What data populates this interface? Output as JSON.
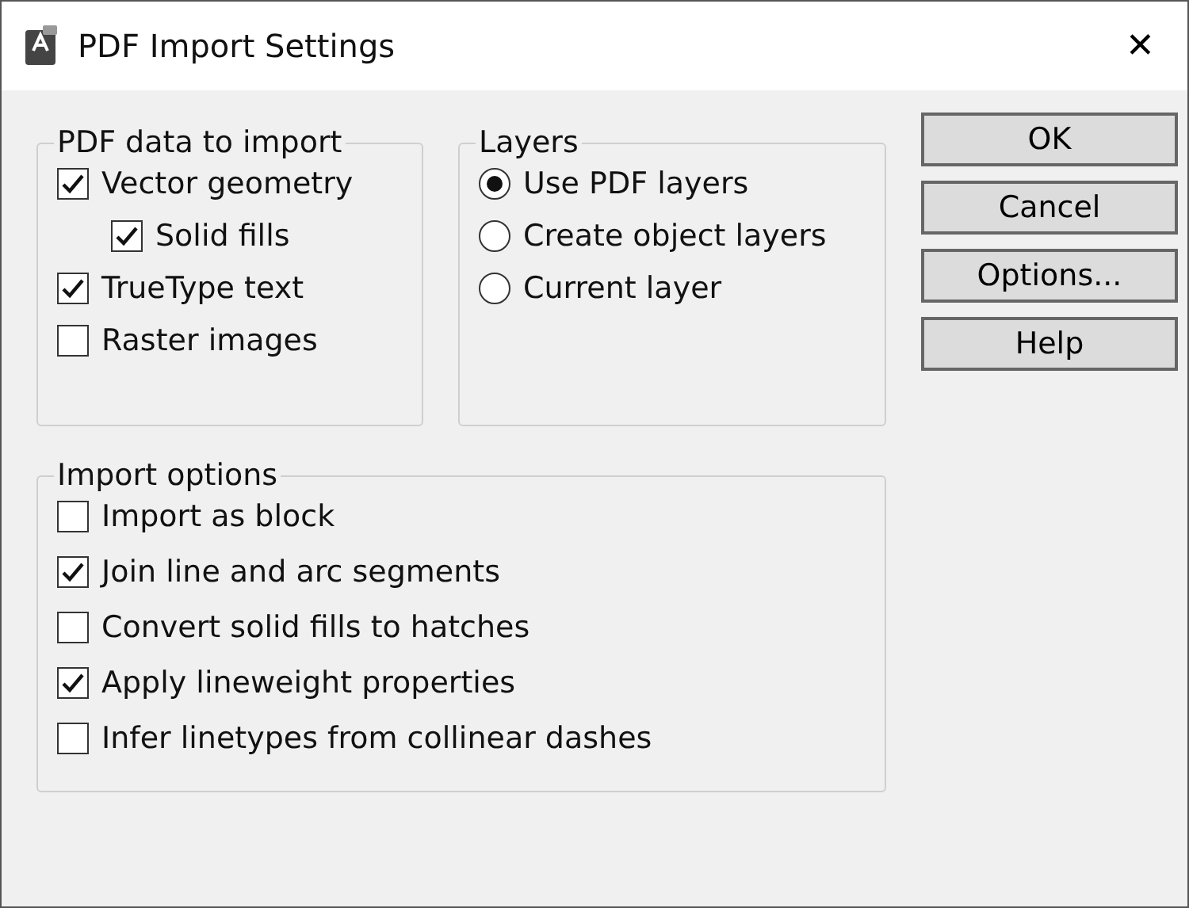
{
  "window": {
    "title": "PDF Import Settings",
    "close": "✕"
  },
  "pdf_data": {
    "title": "PDF data to import",
    "items": [
      {
        "label": "Vector geometry",
        "checked": true,
        "children": [
          {
            "label": "Solid fills",
            "checked": true
          }
        ]
      },
      {
        "label": "TrueType text",
        "checked": true
      },
      {
        "label": "Raster images",
        "checked": false
      }
    ]
  },
  "layers": {
    "title": "Layers",
    "options": [
      {
        "label": "Use PDF layers",
        "selected": true
      },
      {
        "label": "Create object layers",
        "selected": false
      },
      {
        "label": "Current layer",
        "selected": false
      }
    ]
  },
  "buttons": [
    "OK",
    "Cancel",
    "Options...",
    "Help"
  ],
  "import_options": {
    "title": "Import options",
    "items": [
      {
        "label": "Import as block",
        "checked": false
      },
      {
        "label": "Join line and arc segments",
        "checked": true
      },
      {
        "label": "Convert solid fills to hatches",
        "checked": false
      },
      {
        "label": "Apply lineweight properties",
        "checked": true
      },
      {
        "label": "Infer linetypes from collinear dashes",
        "checked": false
      }
    ]
  }
}
